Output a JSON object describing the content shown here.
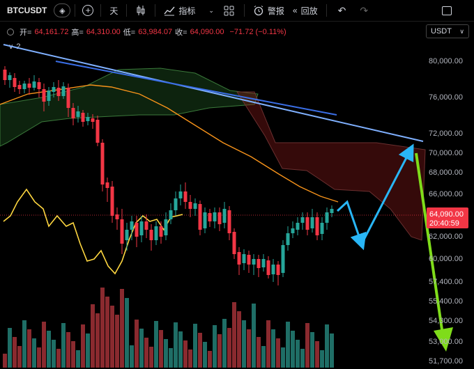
{
  "toolbar": {
    "symbol": "BTCUSDT",
    "interval": "天",
    "indicators_label": "指标",
    "alert_label": "警报",
    "replay_label": "回放"
  },
  "ohlc": {
    "open_label": "开=",
    "open": "64,161.72",
    "high_label": "高=",
    "high": "64,310.00",
    "low_label": "低=",
    "low": "63,984.07",
    "close_label": "收=",
    "close": "64,090.00",
    "change": "−71.72 (−0.11%)"
  },
  "indicator_tag": {
    "count": "2"
  },
  "currency": "USDT",
  "price_axis": {
    "ticks": [
      "80,000.00",
      "76,000.00",
      "72,000.00",
      "70,000.00",
      "68,000.00",
      "66,000.00",
      "62,000.00",
      "60,000.00",
      "57,400.00",
      "55,400.00",
      "54,300.00",
      "53,000.00",
      "51,700.00"
    ],
    "current_price": "64,090.00",
    "countdown": "20:40:59"
  },
  "colors": {
    "up": "#26a69a",
    "down": "#f23645",
    "ema_orange": "#f7931a",
    "yellow": "#ffd740",
    "blue_line": "#5b8def",
    "arrow_blue": "#29b6f6",
    "arrow_green": "#7fdc1a"
  }
}
